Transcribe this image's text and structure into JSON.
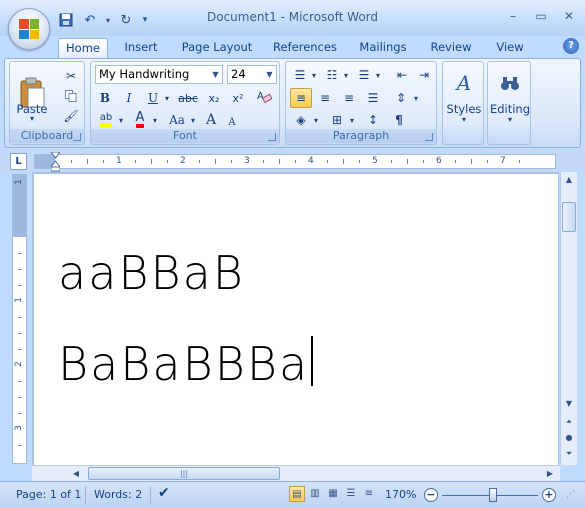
{
  "window": {
    "title": "Document1 - Microsoft Word",
    "minimize": "–",
    "restore": "▭",
    "close": "✕"
  },
  "tabs": [
    {
      "label": "Home",
      "active": true
    },
    {
      "label": "Insert"
    },
    {
      "label": "Page Layout"
    },
    {
      "label": "References"
    },
    {
      "label": "Mailings"
    },
    {
      "label": "Review"
    },
    {
      "label": "View"
    }
  ],
  "ribbon": {
    "clipboard": {
      "label": "Clipboard",
      "paste_label": "Paste"
    },
    "font": {
      "label": "Font",
      "font_name": "My Handwriting",
      "font_size": "24",
      "bold": "B",
      "italic": "I",
      "underline": "U",
      "strikethrough": "abc",
      "subscript": "x₂",
      "superscript": "x²",
      "change_case": "Aa",
      "grow_font": "A",
      "shrink_font": "A",
      "highlight": "ab",
      "font_color": "A"
    },
    "paragraph": {
      "label": "Paragraph",
      "pilcrow": "¶"
    },
    "styles": {
      "label": "Styles"
    },
    "editing": {
      "label": "Editing"
    }
  },
  "document": {
    "lines": [
      "aaBBaB",
      "BaBaBBBa"
    ]
  },
  "status": {
    "page": "Page: 1 of 1",
    "words": "Words: 2",
    "zoom": "170%",
    "zoom_fraction": 0.53
  },
  "ruler": {
    "numbers": [
      "1",
      "2",
      "3",
      "4",
      "5",
      "6",
      "7"
    ],
    "vnumbers": [
      "1",
      "2",
      "3"
    ]
  },
  "colors": {
    "highlight": "#ffff00",
    "font_color": "#ff0000",
    "accent": "#15428b"
  }
}
